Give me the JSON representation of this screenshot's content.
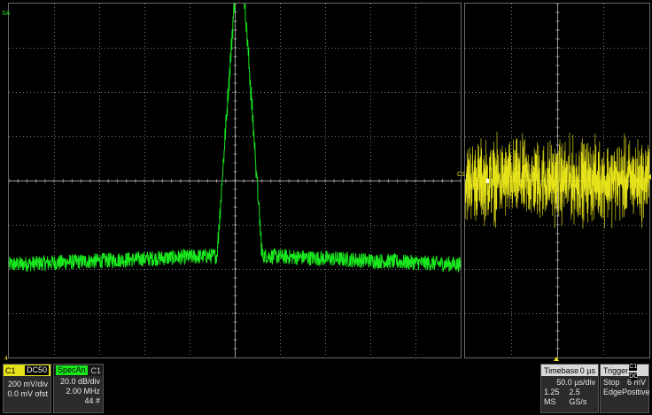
{
  "colors": {
    "c1": "#e6e21a",
    "specan": "#19e81d",
    "grid": "#7a7a7a"
  },
  "markers": {
    "spec_channel_tag": "SA",
    "c1_tag": "C1",
    "c1_bottom_tag": "4"
  },
  "c1_descriptor": {
    "channel": "C1",
    "coupling": "DC50",
    "scale": "200 mV/div",
    "offset": "0.0 mV ofst"
  },
  "specan_descriptor": {
    "name": "SpecAn",
    "source": "C1",
    "scale": "20.0 dB/div",
    "span": "2.00 MHz",
    "count": "44 #"
  },
  "timebase": {
    "label": "Timebase",
    "delay": "0 µs",
    "per_div": "50.0 µs/div",
    "samples": "1.25 MS",
    "rate": "2.5 GS/s"
  },
  "trigger": {
    "label": "Trigger",
    "source_badges": [
      "C1",
      "DC"
    ],
    "mode": "Stop",
    "level": "6 mV",
    "type": "Edge",
    "slope": "Positive"
  },
  "spectrum_trace": {
    "floor_db": -38,
    "peak_db": 85,
    "edges_fraction": [
      0.46,
      0.5,
      0.52,
      0.56
    ]
  },
  "time_trace": {
    "center_mv": 0,
    "amplitude_mv": 160
  }
}
